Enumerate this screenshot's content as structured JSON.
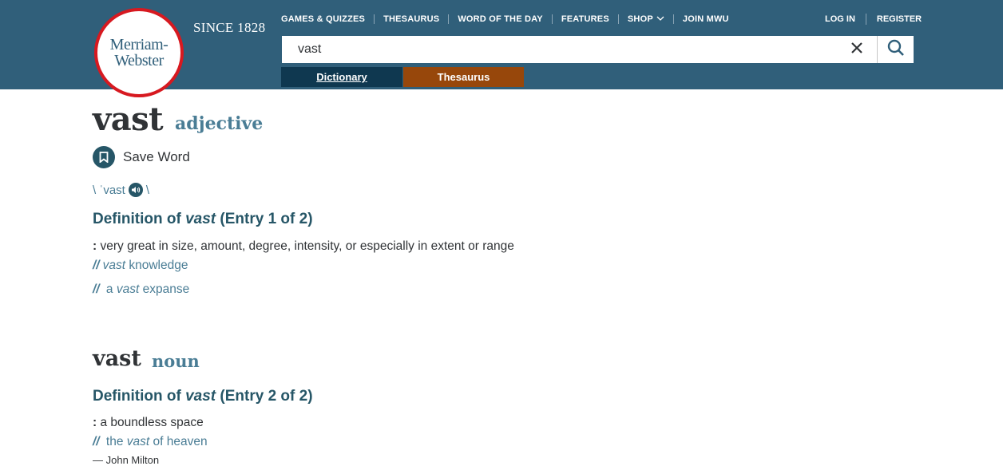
{
  "header": {
    "logo_line1": "Merriam-",
    "logo_line2": "Webster",
    "since": "SINCE 1828",
    "nav": [
      "GAMES & QUIZZES",
      "THESAURUS",
      "WORD OF THE DAY",
      "FEATURES",
      "SHOP",
      "JOIN MWU"
    ],
    "login": "LOG IN",
    "register": "REGISTER",
    "search_value": "vast",
    "tab_dictionary": "Dictionary",
    "tab_thesaurus": "Thesaurus"
  },
  "entry1": {
    "headword": "vast",
    "pos": "adjective",
    "save_word": "Save Word",
    "pron_open": "\\ ˈvast",
    "pron_close": "\\",
    "def_prefix": "Definition of ",
    "def_word": "vast",
    "def_suffix": " (Entry 1 of 2)",
    "sense_colon": ":",
    "sense_text": " very great in size, amount, degree, intensity, or especially in extent or range",
    "ex1_slash": "//",
    "ex1_word": "vast",
    "ex1_rest": " knowledge",
    "ex2_slash": "//",
    "ex2_pre": " a ",
    "ex2_word": "vast",
    "ex2_rest": " expanse"
  },
  "entry2": {
    "headword": "vast",
    "pos": "noun",
    "def_prefix": "Definition of ",
    "def_word": "vast",
    "def_suffix": " (Entry 2 of 2)",
    "sense_colon": ":",
    "sense_text": " a boundless space",
    "ex_slash": "//",
    "ex_pre": " the ",
    "ex_word": "vast",
    "ex_rest": " of heaven",
    "attribution": "— John Milton"
  },
  "colors": {
    "header_bg": "#305f7a",
    "tab_dictionary": "#0f3850",
    "tab_thesaurus": "#97470b",
    "logo_ring": "#d71920",
    "accent_text": "#4a7d95"
  }
}
